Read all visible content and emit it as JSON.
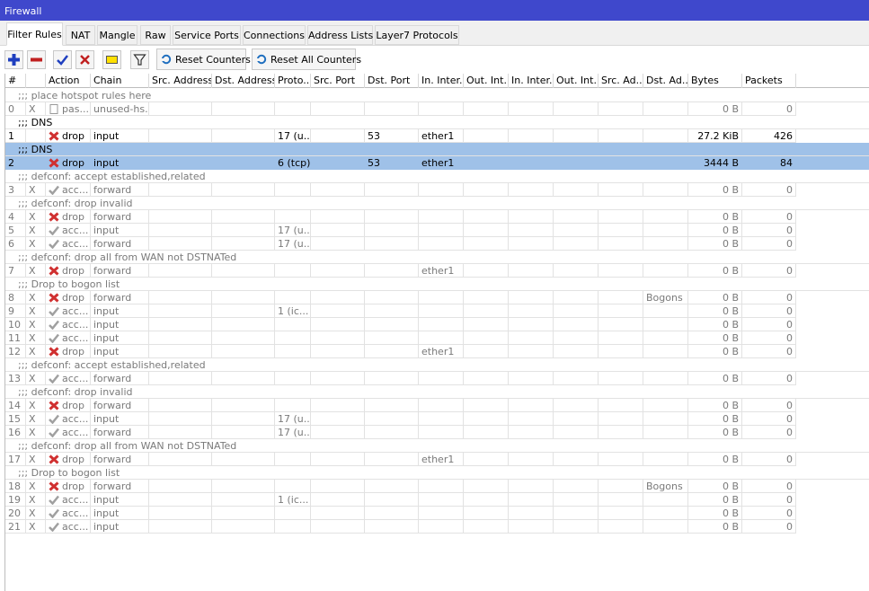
{
  "window": {
    "title": "Firewall"
  },
  "tabs": [
    {
      "label": "Filter Rules",
      "active": true
    },
    {
      "label": "NAT"
    },
    {
      "label": "Mangle"
    },
    {
      "label": "Raw"
    },
    {
      "label": "Service Ports"
    },
    {
      "label": "Connections"
    },
    {
      "label": "Address Lists"
    },
    {
      "label": "Layer7 Protocols"
    }
  ],
  "toolbar": {
    "add_icon": "plus-icon",
    "remove_icon": "minus-icon",
    "enable_icon": "check-icon",
    "disable_icon": "x-icon",
    "comment_icon": "comment-icon",
    "filter_icon": "filter-icon",
    "reset_counters": "Reset Counters",
    "reset_all_counters": "Reset All Counters"
  },
  "columns": [
    "#",
    "",
    "Action",
    "Chain",
    "Src. Address",
    "Dst. Address",
    "Proto...",
    "Src. Port",
    "Dst. Port",
    "In. Inter...",
    "Out. Int...",
    "In. Inter...",
    "Out. Int...",
    "Src. Ad...",
    "Dst. Ad...",
    "Bytes",
    "Packets"
  ],
  "colors": {
    "selected_row": "#9fc1e8",
    "titlebar": "#3f48cc",
    "drop_icon": "#d03030",
    "accept_icon": "#a0a0a0"
  },
  "rows": [
    {
      "type": "comment",
      "text": ";;; place hotspot rules here",
      "disabled": true
    },
    {
      "type": "rule",
      "num": "0",
      "flag": "X",
      "action_icon": "page-icon",
      "action": "pas...",
      "chain": "unused-hs...",
      "proto": "",
      "dst_port": "",
      "in_iface": "",
      "dst_addr_list": "",
      "bytes": "0 B",
      "packets": "0",
      "disabled": true
    },
    {
      "type": "comment",
      "text": ";;; DNS",
      "disabled": false
    },
    {
      "type": "rule",
      "num": "1",
      "flag": "",
      "action_icon": "drop-icon",
      "action": "drop",
      "chain": "input",
      "proto": "17 (u...",
      "dst_port": "53",
      "in_iface": "ether1",
      "dst_addr_list": "",
      "bytes": "27.2 KiB",
      "packets": "426",
      "disabled": false
    },
    {
      "type": "comment",
      "text": ";;; DNS",
      "disabled": false,
      "selected": true
    },
    {
      "type": "rule",
      "num": "2",
      "flag": "",
      "action_icon": "drop-icon",
      "action": "drop",
      "chain": "input",
      "proto": "6 (tcp)",
      "dst_port": "53",
      "in_iface": "ether1",
      "dst_addr_list": "",
      "bytes": "3444 B",
      "packets": "84",
      "disabled": false,
      "selected": true
    },
    {
      "type": "comment",
      "text": ";;; defconf: accept established,related",
      "disabled": true
    },
    {
      "type": "rule",
      "num": "3",
      "flag": "X",
      "action_icon": "accept-icon",
      "action": "acc...",
      "chain": "forward",
      "proto": "",
      "dst_port": "",
      "in_iface": "",
      "dst_addr_list": "",
      "bytes": "0 B",
      "packets": "0",
      "disabled": true
    },
    {
      "type": "comment",
      "text": ";;; defconf: drop invalid",
      "disabled": true
    },
    {
      "type": "rule",
      "num": "4",
      "flag": "X",
      "action_icon": "drop-icon",
      "action": "drop",
      "chain": "forward",
      "proto": "",
      "dst_port": "",
      "in_iface": "",
      "dst_addr_list": "",
      "bytes": "0 B",
      "packets": "0",
      "disabled": true
    },
    {
      "type": "rule",
      "num": "5",
      "flag": "X",
      "action_icon": "accept-icon",
      "action": "acc...",
      "chain": "input",
      "proto": "17 (u...",
      "dst_port": "",
      "in_iface": "",
      "dst_addr_list": "",
      "bytes": "0 B",
      "packets": "0",
      "disabled": true
    },
    {
      "type": "rule",
      "num": "6",
      "flag": "X",
      "action_icon": "accept-icon",
      "action": "acc...",
      "chain": "forward",
      "proto": "17 (u...",
      "dst_port": "",
      "in_iface": "",
      "dst_addr_list": "",
      "bytes": "0 B",
      "packets": "0",
      "disabled": true
    },
    {
      "type": "comment",
      "text": ";;; defconf:  drop all from WAN not DSTNATed",
      "disabled": true
    },
    {
      "type": "rule",
      "num": "7",
      "flag": "X",
      "action_icon": "drop-icon",
      "action": "drop",
      "chain": "forward",
      "proto": "",
      "dst_port": "",
      "in_iface": "ether1",
      "dst_addr_list": "",
      "bytes": "0 B",
      "packets": "0",
      "disabled": true
    },
    {
      "type": "comment",
      "text": ";;; Drop to bogon list",
      "disabled": true
    },
    {
      "type": "rule",
      "num": "8",
      "flag": "X",
      "action_icon": "drop-icon",
      "action": "drop",
      "chain": "forward",
      "proto": "",
      "dst_port": "",
      "in_iface": "",
      "dst_addr_list": "Bogons",
      "bytes": "0 B",
      "packets": "0",
      "disabled": true
    },
    {
      "type": "rule",
      "num": "9",
      "flag": "X",
      "action_icon": "accept-icon",
      "action": "acc...",
      "chain": "input",
      "proto": "1 (ic...",
      "dst_port": "",
      "in_iface": "",
      "dst_addr_list": "",
      "bytes": "0 B",
      "packets": "0",
      "disabled": true
    },
    {
      "type": "rule",
      "num": "10",
      "flag": "X",
      "action_icon": "accept-icon",
      "action": "acc...",
      "chain": "input",
      "proto": "",
      "dst_port": "",
      "in_iface": "",
      "dst_addr_list": "",
      "bytes": "0 B",
      "packets": "0",
      "disabled": true
    },
    {
      "type": "rule",
      "num": "11",
      "flag": "X",
      "action_icon": "accept-icon",
      "action": "acc...",
      "chain": "input",
      "proto": "",
      "dst_port": "",
      "in_iface": "",
      "dst_addr_list": "",
      "bytes": "0 B",
      "packets": "0",
      "disabled": true
    },
    {
      "type": "rule",
      "num": "12",
      "flag": "X",
      "action_icon": "drop-icon",
      "action": "drop",
      "chain": "input",
      "proto": "",
      "dst_port": "",
      "in_iface": "ether1",
      "dst_addr_list": "",
      "bytes": "0 B",
      "packets": "0",
      "disabled": true
    },
    {
      "type": "comment",
      "text": ";;; defconf: accept established,related",
      "disabled": true
    },
    {
      "type": "rule",
      "num": "13",
      "flag": "X",
      "action_icon": "accept-icon",
      "action": "acc...",
      "chain": "forward",
      "proto": "",
      "dst_port": "",
      "in_iface": "",
      "dst_addr_list": "",
      "bytes": "0 B",
      "packets": "0",
      "disabled": true
    },
    {
      "type": "comment",
      "text": ";;; defconf: drop invalid",
      "disabled": true
    },
    {
      "type": "rule",
      "num": "14",
      "flag": "X",
      "action_icon": "drop-icon",
      "action": "drop",
      "chain": "forward",
      "proto": "",
      "dst_port": "",
      "in_iface": "",
      "dst_addr_list": "",
      "bytes": "0 B",
      "packets": "0",
      "disabled": true
    },
    {
      "type": "rule",
      "num": "15",
      "flag": "X",
      "action_icon": "accept-icon",
      "action": "acc...",
      "chain": "input",
      "proto": "17 (u...",
      "dst_port": "",
      "in_iface": "",
      "dst_addr_list": "",
      "bytes": "0 B",
      "packets": "0",
      "disabled": true
    },
    {
      "type": "rule",
      "num": "16",
      "flag": "X",
      "action_icon": "accept-icon",
      "action": "acc...",
      "chain": "forward",
      "proto": "17 (u...",
      "dst_port": "",
      "in_iface": "",
      "dst_addr_list": "",
      "bytes": "0 B",
      "packets": "0",
      "disabled": true
    },
    {
      "type": "comment",
      "text": ";;; defconf:  drop all from WAN not DSTNATed",
      "disabled": true
    },
    {
      "type": "rule",
      "num": "17",
      "flag": "X",
      "action_icon": "drop-icon",
      "action": "drop",
      "chain": "forward",
      "proto": "",
      "dst_port": "",
      "in_iface": "ether1",
      "dst_addr_list": "",
      "bytes": "0 B",
      "packets": "0",
      "disabled": true
    },
    {
      "type": "comment",
      "text": ";;; Drop to bogon list",
      "disabled": true
    },
    {
      "type": "rule",
      "num": "18",
      "flag": "X",
      "action_icon": "drop-icon",
      "action": "drop",
      "chain": "forward",
      "proto": "",
      "dst_port": "",
      "in_iface": "",
      "dst_addr_list": "Bogons",
      "bytes": "0 B",
      "packets": "0",
      "disabled": true
    },
    {
      "type": "rule",
      "num": "19",
      "flag": "X",
      "action_icon": "accept-icon",
      "action": "acc...",
      "chain": "input",
      "proto": "1 (ic...",
      "dst_port": "",
      "in_iface": "",
      "dst_addr_list": "",
      "bytes": "0 B",
      "packets": "0",
      "disabled": true
    },
    {
      "type": "rule",
      "num": "20",
      "flag": "X",
      "action_icon": "accept-icon",
      "action": "acc...",
      "chain": "input",
      "proto": "",
      "dst_port": "",
      "in_iface": "",
      "dst_addr_list": "",
      "bytes": "0 B",
      "packets": "0",
      "disabled": true
    },
    {
      "type": "rule",
      "num": "21",
      "flag": "X",
      "action_icon": "accept-icon",
      "action": "acc...",
      "chain": "input",
      "proto": "",
      "dst_port": "",
      "in_iface": "",
      "dst_addr_list": "",
      "bytes": "0 B",
      "packets": "0",
      "disabled": true
    }
  ]
}
